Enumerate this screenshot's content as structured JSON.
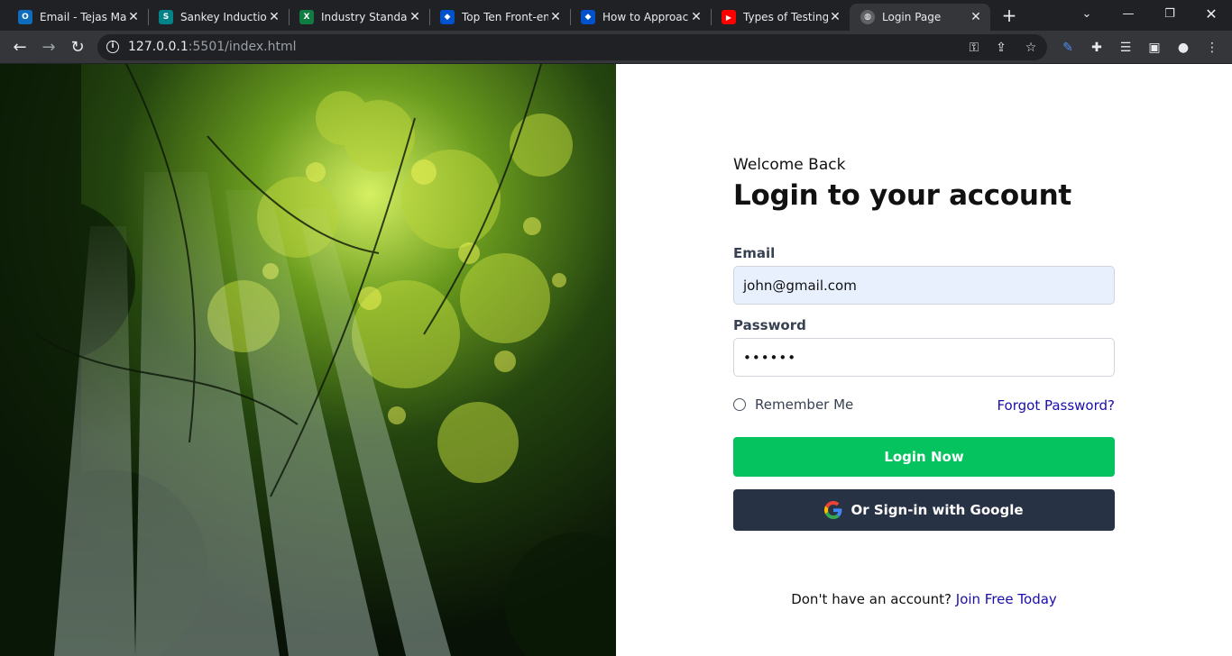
{
  "browser": {
    "tabs": [
      {
        "title": "Email - Tejas Mag",
        "icon": "outlook-icon",
        "color": "#0f6cbd",
        "glyph": "O"
      },
      {
        "title": "Sankey Induction",
        "icon": "sharepoint-icon",
        "color": "#038387",
        "glyph": "S"
      },
      {
        "title": "Industry Standard",
        "icon": "excel-icon",
        "color": "#107c41",
        "glyph": "X"
      },
      {
        "title": "Top Ten Front-en",
        "icon": "jira-icon",
        "color": "#0052cc",
        "glyph": "◆"
      },
      {
        "title": "How to Approach",
        "icon": "jira-icon",
        "color": "#0052cc",
        "glyph": "◆"
      },
      {
        "title": "Types of Testing",
        "icon": "youtube-icon",
        "color": "#ff0000",
        "glyph": "▶"
      },
      {
        "title": "Login Page",
        "icon": "globe-icon",
        "color": "#5f6368",
        "glyph": "◍"
      }
    ],
    "address": {
      "host": "127.0.0.1",
      "rest": ":5501/index.html"
    }
  },
  "login": {
    "welcome": "Welcome Back",
    "heading": "Login to your account",
    "email_label": "Email",
    "email_value": "john@gmail.com",
    "password_label": "Password",
    "password_value": "••••••",
    "remember_label": "Remember Me",
    "forgot_label": "Forgot Password?",
    "login_button": "Login Now",
    "google_button": "Or Sign-in with Google",
    "signup_prompt": "Don't have an account?",
    "signup_link": "Join Free Today"
  },
  "colors": {
    "login_button": "#05c35f",
    "google_button": "#273244",
    "link": "#1a0dab"
  }
}
